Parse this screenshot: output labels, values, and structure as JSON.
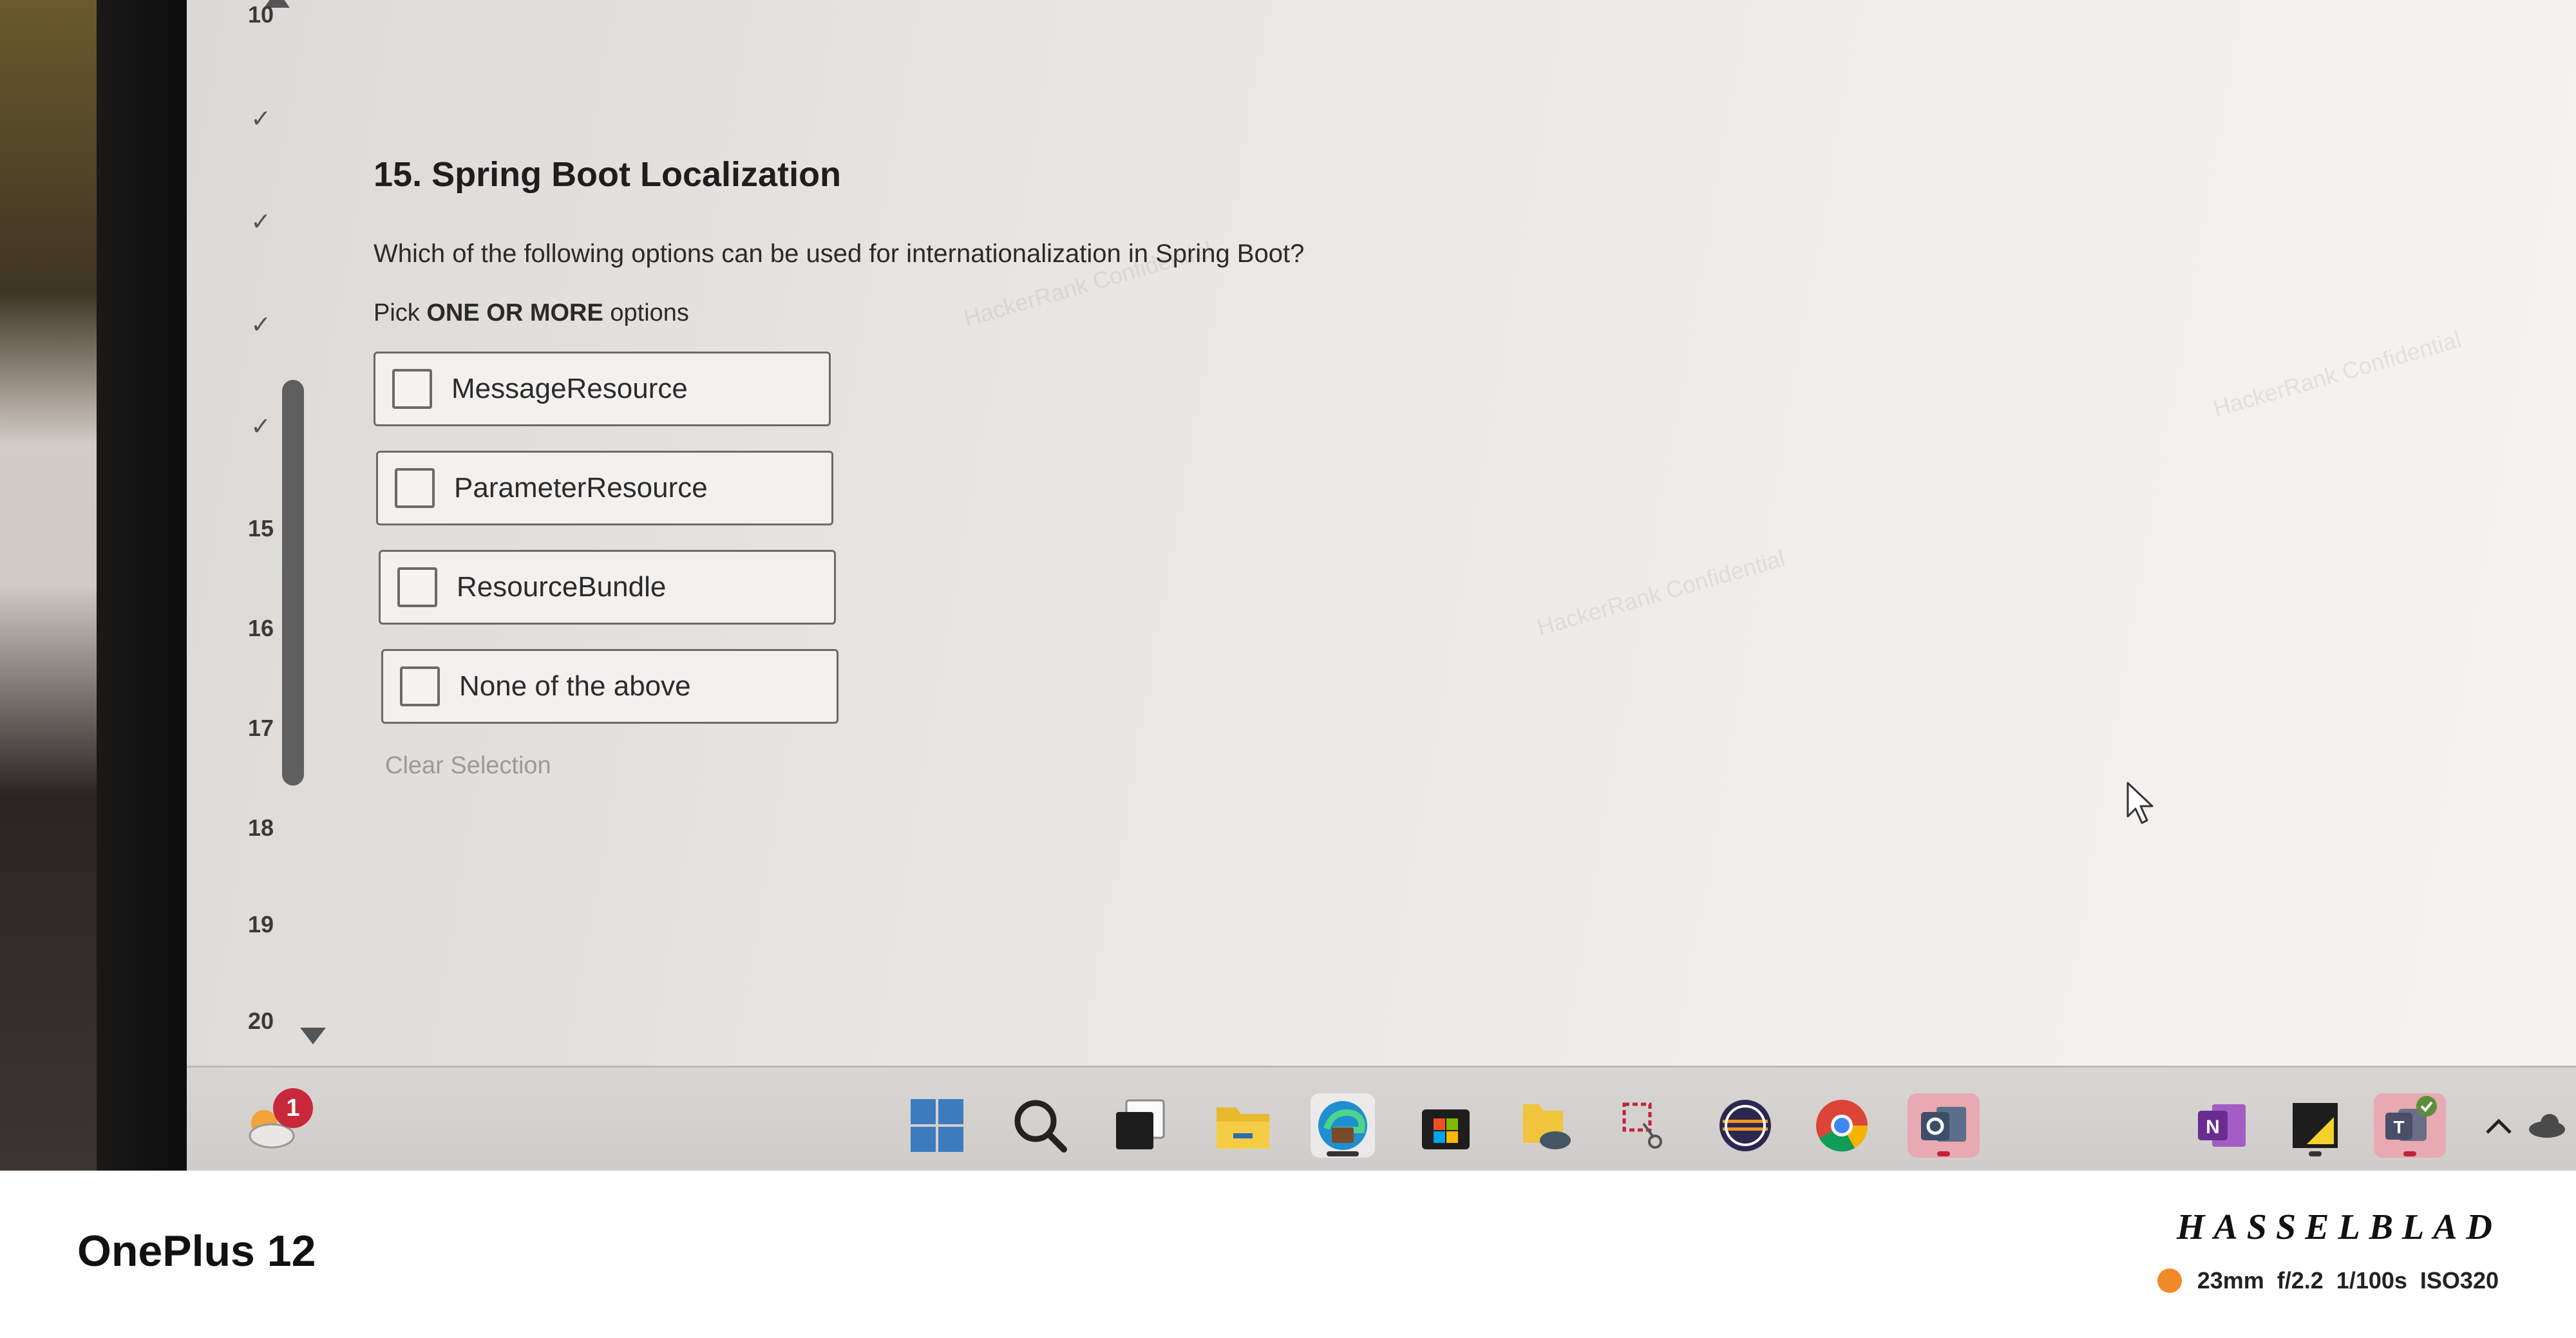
{
  "question_nav": {
    "items": [
      {
        "label": "10",
        "type": "number"
      },
      {
        "label": "✓",
        "type": "check"
      },
      {
        "label": "✓",
        "type": "check"
      },
      {
        "label": "✓",
        "type": "check"
      },
      {
        "label": "✓",
        "type": "check"
      },
      {
        "label": "15",
        "type": "number",
        "active": true
      },
      {
        "label": "16",
        "type": "number"
      },
      {
        "label": "17",
        "type": "number"
      },
      {
        "label": "18",
        "type": "number"
      },
      {
        "label": "19",
        "type": "number"
      },
      {
        "label": "20",
        "type": "number"
      }
    ]
  },
  "question": {
    "title": "15. Spring Boot Localization",
    "text": "Which of the following options can be used for internationalization in Spring Boot?",
    "pick_prefix": "Pick ",
    "pick_emphasis": "ONE OR MORE",
    "pick_suffix": " options",
    "options": [
      {
        "label": "MessageResource",
        "checked": false
      },
      {
        "label": "ParameterResource",
        "checked": false
      },
      {
        "label": "ResourceBundle",
        "checked": false
      },
      {
        "label": "None of the above",
        "checked": false
      }
    ],
    "clear_label": "Clear Selection"
  },
  "taskbar": {
    "weather_badge": "1",
    "icons": [
      "weather-icon",
      "windows-start-icon",
      "search-icon",
      "task-view-icon",
      "file-explorer-icon",
      "edge-icon",
      "store-icon",
      "onedrive-folder-icon",
      "snipping-tool-icon",
      "eclipse-icon",
      "chrome-icon",
      "outlook-icon",
      "onenote-icon",
      "sticky-notes-icon",
      "teams-icon",
      "tray-chevron-icon",
      "cloud-icon"
    ]
  },
  "footer": {
    "device": "OnePlus 12",
    "brand": "HASSELBLAD",
    "exif": "23mm  f/2.2  1/100s  ISO320",
    "exif_dot_color": "#f08a28"
  },
  "colors": {
    "screen_bg": "#e8e5e3",
    "taskbar_bg": "#d2d0cd",
    "badge": "#c9283a",
    "outlook_highlight": "#e8a9b3"
  }
}
